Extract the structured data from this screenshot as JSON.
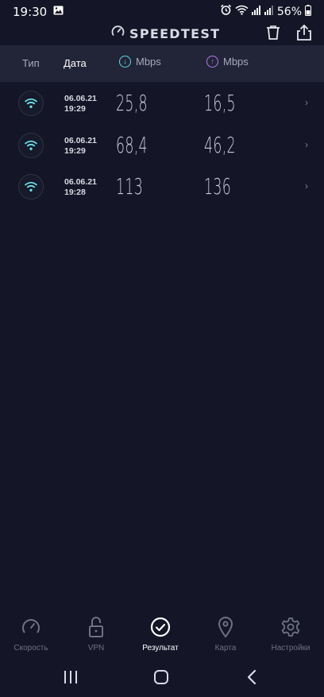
{
  "status_bar": {
    "time": "19:30",
    "battery": "56%"
  },
  "app": {
    "title": "SPEEDTEST"
  },
  "table": {
    "headers": {
      "type": "Тип",
      "date": "Дата",
      "download_unit": "Mbps",
      "upload_unit": "Mbps"
    },
    "rows": [
      {
        "date": "06.06.21",
        "time": "19:29",
        "download": "25,8",
        "upload": "16,5",
        "icon": "wifi-icon"
      },
      {
        "date": "06.06.21",
        "time": "19:29",
        "download": "68,4",
        "upload": "46,2",
        "icon": "wifi-icon"
      },
      {
        "date": "06.06.21",
        "time": "19:28",
        "download": "113",
        "upload": "136",
        "icon": "wifi-icon"
      }
    ]
  },
  "bottom_nav": {
    "items": [
      {
        "label": "Скорость",
        "icon": "speedometer-icon"
      },
      {
        "label": "VPN",
        "icon": "lock-icon"
      },
      {
        "label": "Результат",
        "icon": "check-circle-icon",
        "active": true
      },
      {
        "label": "Карта",
        "icon": "map-pin-icon"
      },
      {
        "label": "Настройки",
        "icon": "gear-icon"
      }
    ]
  },
  "colors": {
    "background": "#141526",
    "header_background": "#222438",
    "download_accent": "#5ed7e0",
    "upload_accent": "#b77cf0",
    "wifi_accent": "#6de0e6"
  }
}
